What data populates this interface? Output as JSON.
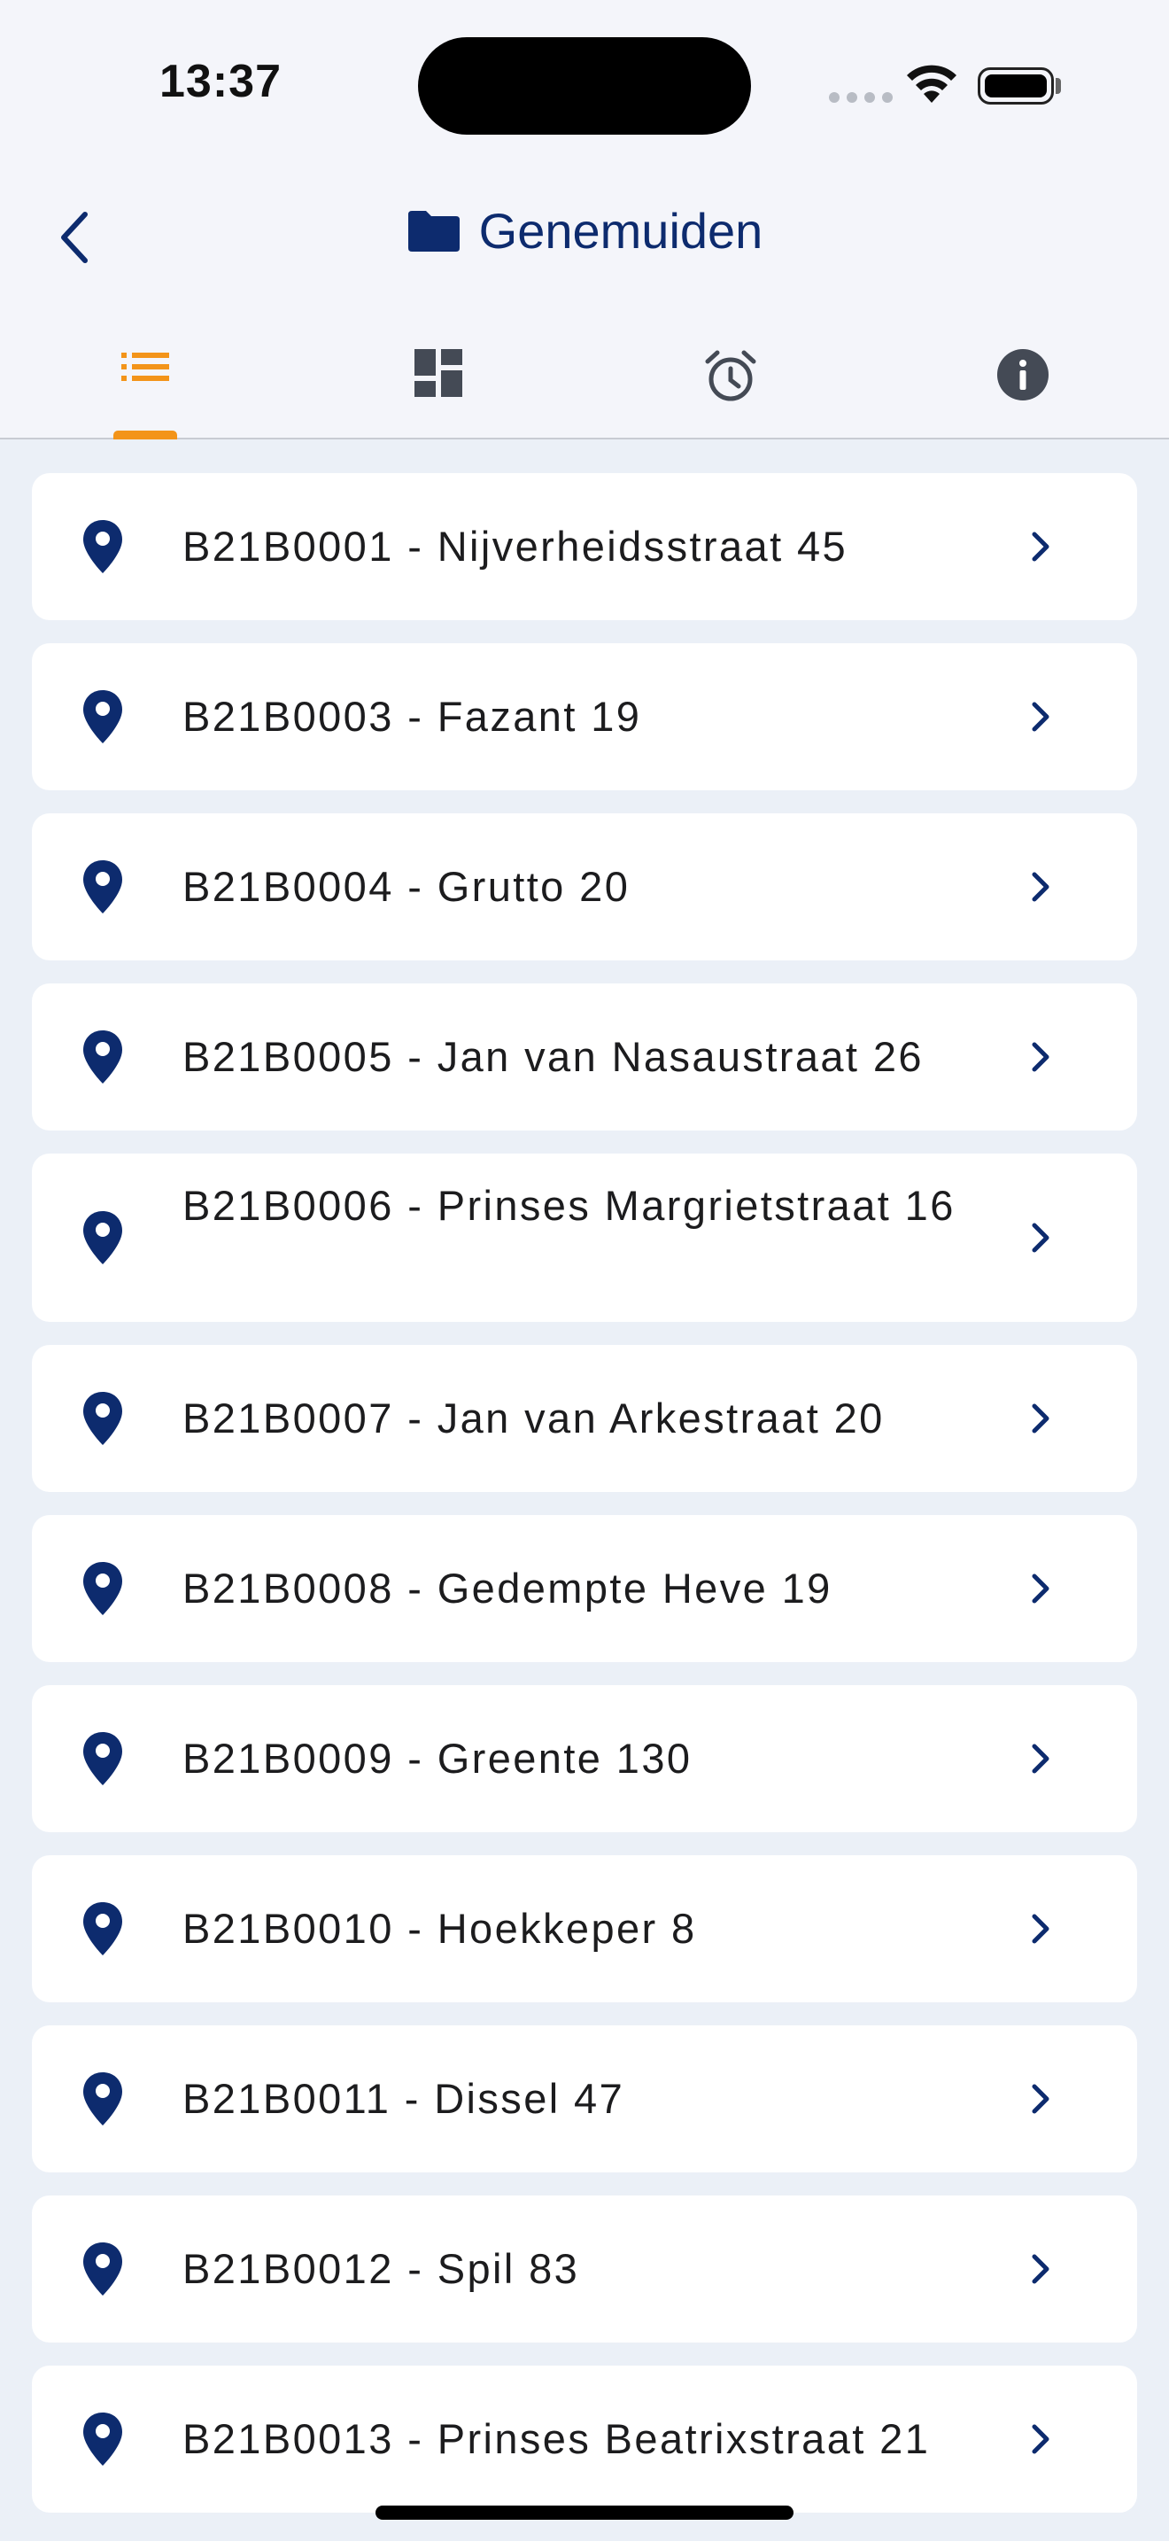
{
  "status_bar": {
    "time": "13:37"
  },
  "nav": {
    "title": "Genemuiden",
    "back_icon": "chevron-left-icon",
    "title_icon": "folder-icon"
  },
  "tabs": [
    {
      "name": "list",
      "icon": "list-icon",
      "selected": true
    },
    {
      "name": "dashboard",
      "icon": "dashboard-icon",
      "selected": false
    },
    {
      "name": "alarm",
      "icon": "alarm-clock-icon",
      "selected": false
    },
    {
      "name": "info",
      "icon": "info-icon",
      "selected": false
    }
  ],
  "colors": {
    "primary": "#0d2b6e",
    "accent": "#f39419",
    "background": "#ebf0f7",
    "header_background": "#f4f5fa",
    "card": "#ffffff"
  },
  "locations": [
    {
      "label": "B21B0001 - Nijverheidsstraat 45"
    },
    {
      "label": "B21B0003 - Fazant 19"
    },
    {
      "label": "B21B0004 - Grutto 20"
    },
    {
      "label": "B21B0005 - Jan van Nasaustraat 26"
    },
    {
      "label": "B21B0006 - Prinses Margrietstraat 16"
    },
    {
      "label": "B21B0007 - Jan van Arkestraat 20"
    },
    {
      "label": "B21B0008 - Gedempte Heve 19"
    },
    {
      "label": "B21B0009 - Greente 130"
    },
    {
      "label": "B21B0010 - Hoekkeper 8"
    },
    {
      "label": "B21B0011 - Dissel 47"
    },
    {
      "label": "B21B0012 - Spil 83"
    },
    {
      "label": "B21B0013 - Prinses Beatrixstraat 21"
    }
  ]
}
